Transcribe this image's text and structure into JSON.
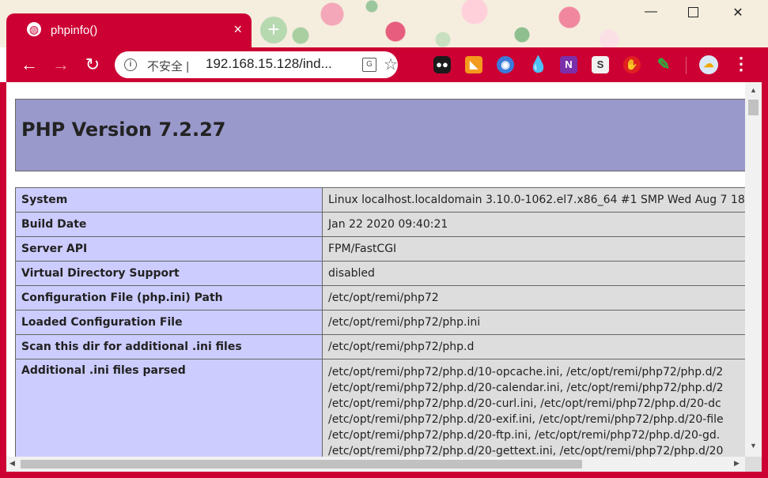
{
  "browser": {
    "tab_title": "phpinfo()",
    "tab_close": "×",
    "new_tab": "+",
    "window_controls": {
      "minimize": "—",
      "close": "✕"
    },
    "nav": {
      "back": "←",
      "forward": "→",
      "reload": "↻"
    },
    "omnibox": {
      "info_icon": "i",
      "security_label": "不安全",
      "separator": "|",
      "url": "192.168.15.128/ind..."
    },
    "translate_icon": "G",
    "star_icon": "☆",
    "extensions": [
      "●●",
      "◣",
      "◉",
      "💧",
      "N",
      "S",
      "✋",
      "✎",
      "☁"
    ],
    "menu_icon": "⋮",
    "accent_color": "#cc0033"
  },
  "page": {
    "heading": "PHP Version 7.2.27",
    "rows": [
      {
        "key": "System",
        "value": "Linux localhost.localdomain 3.10.0-1062.el7.x86_64 #1 SMP Wed Aug 7 18"
      },
      {
        "key": "Build Date",
        "value": "Jan 22 2020 09:40:21"
      },
      {
        "key": "Server API",
        "value": "FPM/FastCGI"
      },
      {
        "key": "Virtual Directory Support",
        "value": "disabled"
      },
      {
        "key": "Configuration File (php.ini) Path",
        "value": "/etc/opt/remi/php72"
      },
      {
        "key": "Loaded Configuration File",
        "value": "/etc/opt/remi/php72/php.ini"
      },
      {
        "key": "Scan this dir for additional .ini files",
        "value": "/etc/opt/remi/php72/php.d"
      }
    ],
    "ini_row": {
      "key": "Additional .ini files parsed",
      "lines": [
        "/etc/opt/remi/php72/php.d/10-opcache.ini, /etc/opt/remi/php72/php.d/2",
        "/etc/opt/remi/php72/php.d/20-calendar.ini, /etc/opt/remi/php72/php.d/2",
        "/etc/opt/remi/php72/php.d/20-curl.ini, /etc/opt/remi/php72/php.d/20-dc",
        "/etc/opt/remi/php72/php.d/20-exif.ini, /etc/opt/remi/php72/php.d/20-file",
        "/etc/opt/remi/php72/php.d/20-ftp.ini, /etc/opt/remi/php72/php.d/20-gd.",
        "/etc/opt/remi/php72/php.d/20-gettext.ini, /etc/opt/remi/php72/php.d/20"
      ]
    },
    "colors": {
      "header": "#9999cc",
      "key_cell": "#ccccff",
      "value_cell": "#dddddd"
    }
  },
  "scrollbars": {
    "up": "▲",
    "down": "▼",
    "left": "◀",
    "right": "▶"
  }
}
